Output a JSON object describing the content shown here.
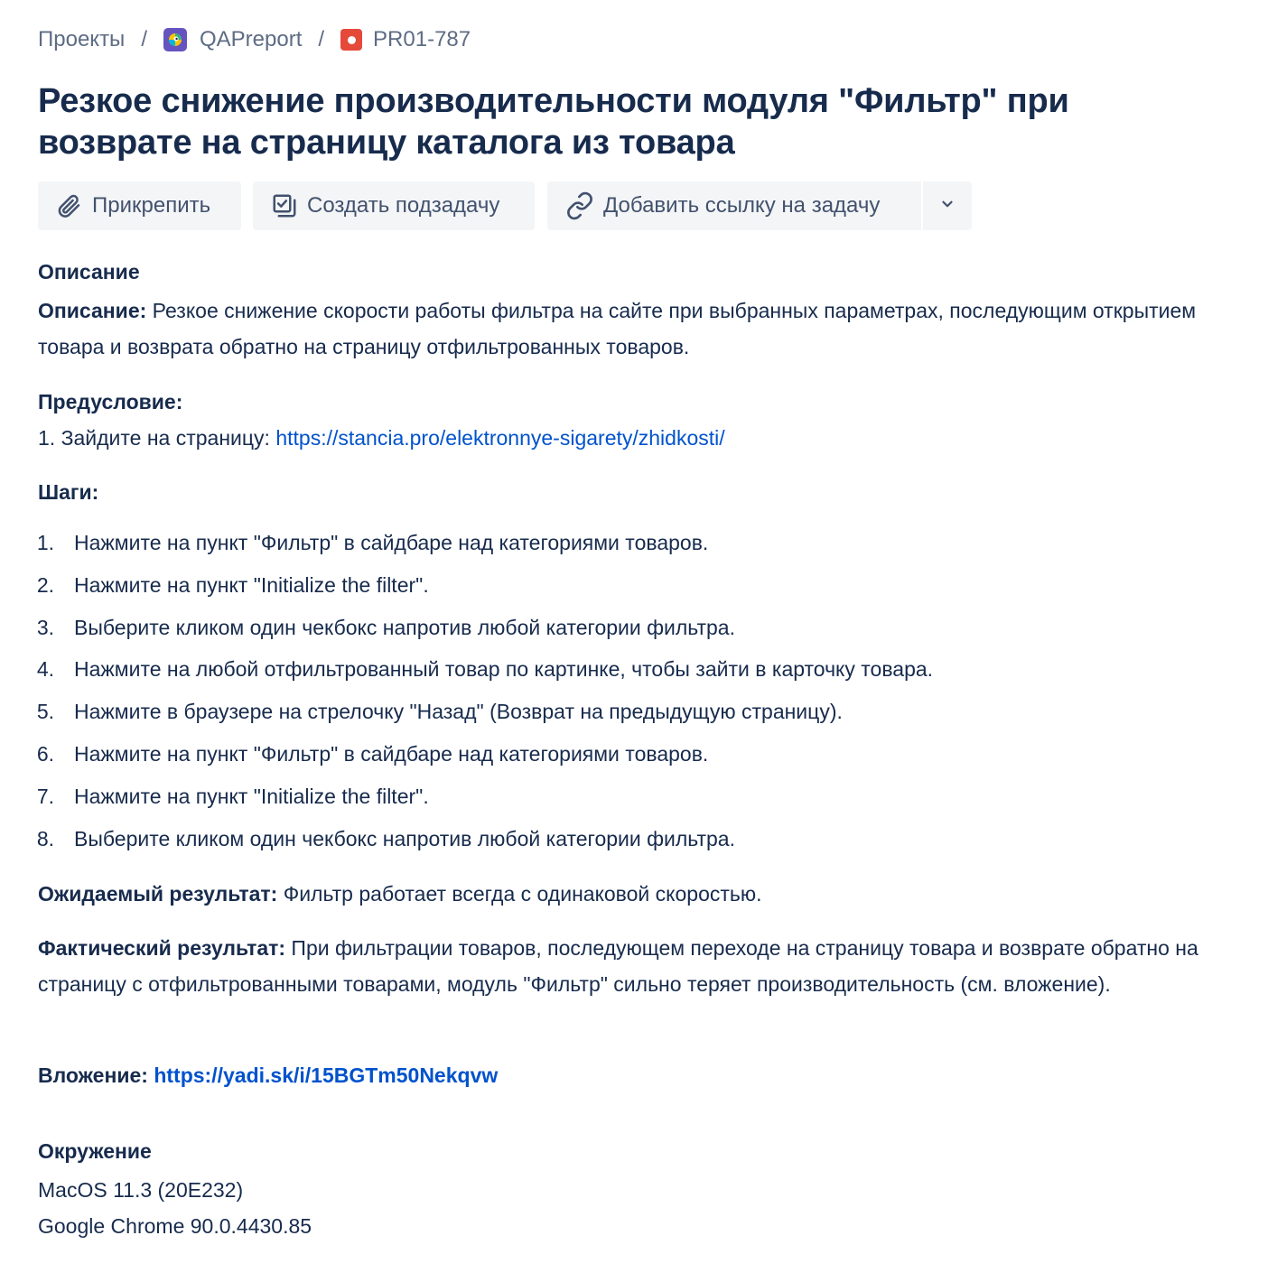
{
  "breadcrumb": {
    "projects": "Проекты",
    "separator": "/",
    "project_name": "QAPreport",
    "issue_key": "PR01-787"
  },
  "title": "Резкое снижение производительности модуля \"Фильтр\" при возврате на страницу каталога из товара",
  "toolbar": {
    "attach_label": "Прикрепить",
    "subtask_label": "Создать подзадачу",
    "link_issue_label": "Добавить ссылку на задачу"
  },
  "description": {
    "heading": "Описание",
    "desc_label": "Описание:",
    "desc_text": "Резкое снижение скорости работы фильтра на сайте при выбранных параметрах, последующим открытием товара и возврата обратно на страницу отфильтрованных товаров.",
    "precondition_label": "Предусловие:",
    "precondition_item_text": "1. Зайдите на страницу: ",
    "precondition_url": "https://stancia.pro/elektronnye-sigarety/zhidkosti/",
    "steps_label": "Шаги:",
    "steps": [
      {
        "num": "1.",
        "text": "Нажмите на пункт \"Фильтр\" в сайдбаре над категориями товаров."
      },
      {
        "num": "2.",
        "text": "Нажмите на пункт \"Initialize the filter\"."
      },
      {
        "num": "3.",
        "text": "Выберите кликом один чекбокс напротив любой категории фильтра."
      },
      {
        "num": "4.",
        "text": "Нажмите на любой отфильтрованный товар по картинке, чтобы зайти в карточку товара."
      },
      {
        "num": "5.",
        "text": "Нажмите в браузере на стрелочку \"Назад\" (Возврат на предыдущую страницу)."
      },
      {
        "num": "6.",
        "text": "Нажмите на пункт \"Фильтр\" в сайдбаре над категориями товаров."
      },
      {
        "num": "7.",
        "text": "Нажмите на пункт \"Initialize the filter\"."
      },
      {
        "num": "8.",
        "text": "Выберите кликом один чекбокс напротив любой категории фильтра."
      }
    ],
    "expected_label": "Ожидаемый результат:",
    "expected_text": " Фильтр работает всегда с одинаковой скоростью.",
    "actual_label": "Фактический результат:",
    "actual_text": " При фильтрации товаров, последующем переходе на страницу товара и возврате обратно на страницу с отфильтрованными товарами, модуль \"Фильтр\" сильно теряет производительность (см. вложение).",
    "attachment_label": "Вложение:",
    "attachment_url": "https://yadi.sk/i/15BGTm50Nekqvw"
  },
  "environment": {
    "heading": "Окружение",
    "os": "MacOS 11.3 (20E232)",
    "browser": "Google Chrome 90.0.4430.85"
  },
  "colors": {
    "text": "#172b4d",
    "muted": "#5e6c84",
    "link": "#0052cc",
    "button_bg": "#f4f5f7",
    "project_avatar": "#6554c0",
    "bug_icon": "#e5493a"
  },
  "icons": {
    "project_avatar": "project-avatar-icon",
    "issue_type": "bug-icon",
    "attach": "paperclip-icon",
    "subtask": "subtask-icon",
    "link": "link-icon",
    "dropdown": "chevron-down-icon"
  }
}
